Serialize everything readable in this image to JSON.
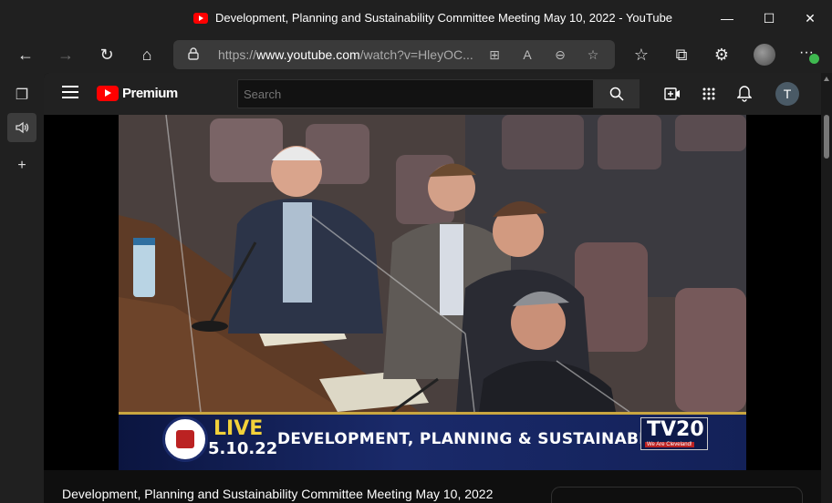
{
  "window": {
    "title": "Development, Planning and Sustainability Committee Meeting May 10, 2022 - YouTube",
    "minimize": "—",
    "maximize": "☐",
    "close": "✕"
  },
  "browser": {
    "url_prefix": "https://",
    "url_domain": "www.youtube.com",
    "url_path": "/watch?v=HleyOC...",
    "icons": {
      "back": "←",
      "forward": "→",
      "refresh": "↻",
      "home": "⌂",
      "lock": "🔒",
      "apps": "⊞",
      "read_aloud": "A",
      "zoom": "⊖",
      "favorite": "☆",
      "favorites": "☆",
      "collections": "⧉",
      "extensions": "⚙",
      "more": "···",
      "tabs": "❐",
      "audio": "🔊",
      "new_tab": "+"
    }
  },
  "youtube": {
    "brand": "Premium",
    "search_placeholder": "Search",
    "user_initial": "T",
    "icons": {
      "search": "search-icon",
      "create": "⊞",
      "apps": "⋮⋮",
      "notifications": "🔔"
    }
  },
  "video": {
    "overlay_live": "LIVE",
    "overlay_date": "5.10.22",
    "overlay_committee": "DEVELOPMENT, PLANNING & SUSTAINABILITY",
    "overlay_channel": "TV20",
    "overlay_tagline": "We Are Cleveland!"
  },
  "meta": {
    "title": "Development, Planning and Sustainability Committee Meeting May 10, 2022"
  }
}
